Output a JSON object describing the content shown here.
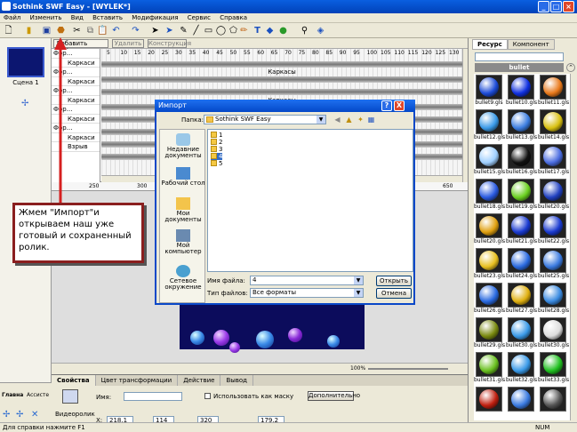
{
  "window": {
    "title": "Sothink SWF Easy - [WYLEK*]",
    "min_label": "_",
    "max_label": "□",
    "close_label": "×"
  },
  "menu": [
    "Файл",
    "Изменить",
    "Вид",
    "Вставить",
    "Модификация",
    "Сервис",
    "Справка"
  ],
  "timeline": {
    "add_effect": "Добавить эффект",
    "delete": "Удалить",
    "construct": "Конструкция",
    "layers": [
      "Фор...",
      "Каркаси",
      "Фор...",
      "Каркаси",
      "Фор...",
      "Каркаси",
      "Фор...",
      "Каркаси",
      "Фор...",
      "Каркаси",
      "Взрыв"
    ],
    "frame_labels": [
      "Каркасы",
      "Каркасы",
      "Каркасы",
      "Каркасы"
    ],
    "ruler": [
      "5",
      "10",
      "15",
      "20",
      "25",
      "30",
      "35",
      "40",
      "45",
      "50",
      "55",
      "60",
      "65",
      "70",
      "75",
      "80",
      "85",
      "90",
      "95",
      "100",
      "105",
      "110",
      "115",
      "120",
      "125",
      "130"
    ],
    "stage_ruler": [
      "250",
      "300",
      "650"
    ]
  },
  "scenes": {
    "scene_label": "Сцена 1"
  },
  "left_bottom": {
    "tab_main": "Главна",
    "tab_assets": "Ассисте"
  },
  "properties": {
    "tabs": [
      "Свойства",
      "Цвет трансформации",
      "Действие",
      "Вывод"
    ],
    "name_label": "Имя:",
    "use_mask": "Использовать как маску",
    "advanced": "Дополнительно",
    "video_label": "Видеоролик",
    "x_label": "X:",
    "x_value": "218.1",
    "y_value": "114",
    "w_value": "320",
    "h_value": "179.2",
    "zoom": "100%"
  },
  "resources": {
    "tabs": [
      "Ресурс",
      "Компонент"
    ],
    "folder": "bullet",
    "items": [
      {
        "name": "bullet9.gls",
        "color": "#1c4bd8"
      },
      {
        "name": "bullet10.gls",
        "color": "#1030e0"
      },
      {
        "name": "bullet11.gls",
        "color": "#e8781a"
      },
      {
        "name": "bullet12.gls",
        "color": "#3a9ae8"
      },
      {
        "name": "bullet13.gls",
        "color": "#3c7de0"
      },
      {
        "name": "bullet14.gls",
        "color": "#d8c010"
      },
      {
        "name": "bullet15.gls",
        "color": "#9fcfff"
      },
      {
        "name": "bullet16.gls",
        "color": "#111111"
      },
      {
        "name": "bullet17.gls",
        "color": "#4a6ce0"
      },
      {
        "name": "bullet18.gls",
        "color": "#2a5ae0"
      },
      {
        "name": "bullet19.gls",
        "color": "#6ad020"
      },
      {
        "name": "bullet20.gls",
        "color": "#2040c0"
      },
      {
        "name": "bullet20.gls",
        "color": "#e0a010"
      },
      {
        "name": "bullet21.gls",
        "color": "#1a3ad0"
      },
      {
        "name": "bullet22.gls",
        "color": "#1a3ad0"
      },
      {
        "name": "bullet23.gls",
        "color": "#e8c020"
      },
      {
        "name": "bullet24.gls",
        "color": "#2a6ae0"
      },
      {
        "name": "bullet25.gls",
        "color": "#3a7ae0"
      },
      {
        "name": "bullet26.gls",
        "color": "#2a6ae0"
      },
      {
        "name": "bullet27.gls",
        "color": "#e0b010"
      },
      {
        "name": "bullet28.gls",
        "color": "#3a8ae0"
      },
      {
        "name": "bullet29.gls",
        "color": "#7a8a10"
      },
      {
        "name": "bullet30.gls",
        "color": "#3a9ae8"
      },
      {
        "name": "bullet30.gls",
        "color": "#dddddd"
      },
      {
        "name": "bullet31.gls",
        "color": "#6ac020"
      },
      {
        "name": "bullet32.gls",
        "color": "#3a9ae8"
      },
      {
        "name": "bullet33.gls",
        "color": "#20c020"
      },
      {
        "name": "",
        "color": "#c02010"
      },
      {
        "name": "",
        "color": "#3a7ae0"
      },
      {
        "name": "",
        "color": "#555555"
      }
    ]
  },
  "status": {
    "help": "Для справки нажмите F1",
    "num": "NUM"
  },
  "dialog": {
    "title": "Импорт",
    "help": "?",
    "close": "X",
    "look_in_label": "Папка:",
    "look_in_value": "Sothink SWF Easy",
    "places": [
      "Недавние документы",
      "Рабочий стол",
      "Мои документы",
      "Мой компьютер",
      "Сетевое окружение"
    ],
    "files": [
      "1",
      "2",
      "3",
      "4",
      "5"
    ],
    "selected_file": "4",
    "filename_label": "Имя файла:",
    "filename_value": "4",
    "filetype_label": "Тип файлов:",
    "filetype_value": "Все форматы",
    "open": "Открыть",
    "cancel": "Отмена"
  },
  "callout": {
    "text": "Жмем \"Импорт\"и открываем наш уже готовый и сохраненный ролик."
  },
  "colors": {
    "accent": "#0a5fe0",
    "arrow": "#d62020",
    "callout_border": "#8a1e1e",
    "stage": "#0c0c5c"
  }
}
